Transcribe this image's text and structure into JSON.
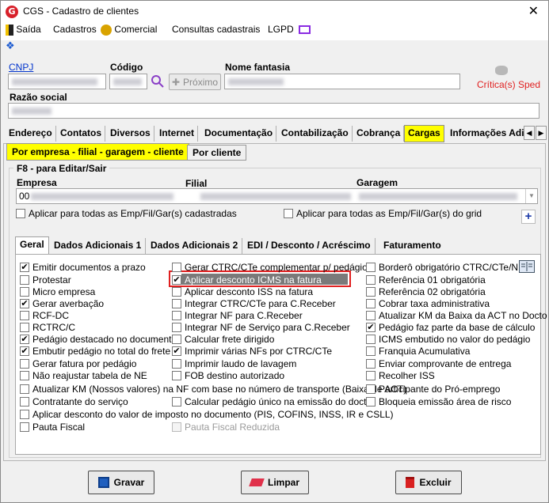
{
  "window": {
    "title": "CGS - Cadastro de clientes",
    "close_glyph": "✕",
    "app_icon": "G"
  },
  "menu": [
    {
      "label": "Saída",
      "icon": "door-exit-icon"
    },
    {
      "label": "Cadastros"
    },
    {
      "label": "Comercial",
      "icon": "coins-icon"
    },
    {
      "label": "Consultas cadastrais"
    },
    {
      "label": "LGPD",
      "icon": "monitor-icon"
    }
  ],
  "header": {
    "cnpj_label": "CNPJ",
    "codigo_label": "Código",
    "nome_fantasia_label": "Nome fantasia",
    "proximo_label": "Próximo",
    "critica_label": "Crítica(s) Sped",
    "razao_social_label": "Razão social",
    "cnpj_prefix": "00"
  },
  "colors": {
    "accent_yellow": "#ffff00",
    "critica_red": "#e02020",
    "link_blue": "#0033cc"
  },
  "tabs_main": [
    {
      "label": "Endereço"
    },
    {
      "label": "Contatos"
    },
    {
      "label": "Diversos"
    },
    {
      "label": "Internet"
    },
    {
      "label": "Documentação"
    },
    {
      "label": "Contabilização"
    },
    {
      "label": "Cobrança"
    },
    {
      "label": "Cargas",
      "active": true
    },
    {
      "label": "Informações Adi"
    }
  ],
  "subtabs": [
    {
      "label": "Por empresa - filial - garagem - cliente",
      "active": true
    },
    {
      "label": "Por cliente"
    }
  ],
  "group": {
    "title": "F8 - para Editar/Sair",
    "empresa_label": "Empresa",
    "filial_label": "Filial",
    "garagem_label": "Garagem",
    "aplicar_cadastradas": "Aplicar para todas as Emp/Fil/Gar(s) cadastradas",
    "aplicar_grid": "Aplicar para todas as Emp/Fil/Gar(s) do grid",
    "add_glyph": "+"
  },
  "tabs_inner": [
    {
      "label": "Geral",
      "active": true
    },
    {
      "label": "Dados Adicionais 1"
    },
    {
      "label": "Dados Adicionais 2"
    },
    {
      "label": "EDI / Desconto / Acréscimo"
    },
    {
      "label": "Faturamento"
    }
  ],
  "col1": [
    {
      "label": "Emitir documentos a prazo",
      "checked": true
    },
    {
      "label": "Protestar",
      "checked": false
    },
    {
      "label": "Micro empresa",
      "checked": false
    },
    {
      "label": "Gerar averbação",
      "checked": true
    },
    {
      "label": "RCF-DC",
      "checked": false
    },
    {
      "label": "RCTRC/C",
      "checked": false
    },
    {
      "label": "Pedágio destacado no documento",
      "checked": true
    },
    {
      "label": "Embutir pedágio no total do frete",
      "checked": true
    },
    {
      "label": "Gerar fatura por pedágio",
      "checked": false
    },
    {
      "label": "Não reajustar tabela de NE",
      "checked": false
    },
    {
      "label": "Atualizar KM (Nossos valores) na NF com base no número de transporte (Baixa de ACT)",
      "checked": false
    },
    {
      "label": "Contratante do serviço",
      "checked": false
    },
    {
      "label": "Aplicar desconto do valor de imposto no documento (PIS, COFINS, INSS, IR e CSLL)",
      "checked": false
    },
    {
      "label": "Pauta Fiscal",
      "checked": false
    }
  ],
  "col2": [
    {
      "label": "Gerar CTRC/CTe complementar p/ pedágio",
      "checked": false
    },
    {
      "label": "Aplicar desconto ICMS na fatura",
      "checked": true
    },
    {
      "label": "Aplicar desconto ISS na fatura",
      "checked": false
    },
    {
      "label": "Integrar CTRC/CTe para C.Receber",
      "checked": false
    },
    {
      "label": "Integrar NF para C.Receber",
      "checked": false
    },
    {
      "label": "Integrar NF de Serviço para C.Receber",
      "checked": false
    },
    {
      "label": "Calcular frete dirigido",
      "checked": false
    },
    {
      "label": "Imprimir várias NFs por CTRC/CTe",
      "checked": true
    },
    {
      "label": "Imprimir laudo de lavagem",
      "checked": false
    },
    {
      "label": "FOB destino autorizado",
      "checked": false
    },
    {
      "label": "Calcular pedágio único na emissão do docto",
      "checked": false
    },
    {
      "label": "Pauta Fiscal Reduzida",
      "checked": false,
      "disabled": true
    }
  ],
  "col3": [
    {
      "label": "Borderô obrigatório  CTRC/CTe/NF",
      "checked": false
    },
    {
      "label": "Referência 01 obrigatória",
      "checked": false
    },
    {
      "label": "Referência 02 obrigatória",
      "checked": false
    },
    {
      "label": "Cobrar taxa administrativa",
      "checked": false
    },
    {
      "label": "Atualizar KM da Baixa da ACT no Docto",
      "checked": false
    },
    {
      "label": "Pedágio faz parte da base de cálculo",
      "checked": true
    },
    {
      "label": "ICMS embutido no valor do pedágio",
      "checked": false
    },
    {
      "label": "Franquia Acumulativa",
      "checked": false
    },
    {
      "label": "Enviar comprovante de entrega",
      "checked": false
    },
    {
      "label": "Recolher ISS",
      "checked": false
    },
    {
      "label": "Participante do Pró-emprego",
      "checked": false
    },
    {
      "label": "Bloqueia emissão área de risco",
      "checked": false
    }
  ],
  "footer": {
    "gravar": "Gravar",
    "limpar": "Limpar",
    "excluir": "Excluir"
  }
}
